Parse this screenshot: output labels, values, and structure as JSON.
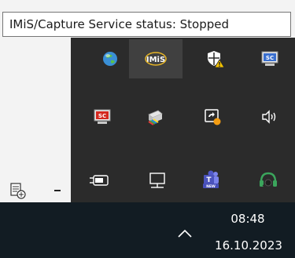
{
  "tooltip": {
    "text": "IMiS/Capture Service status: Stopped"
  },
  "tray": {
    "icons": [
      {
        "name": "edge-globe-icon"
      },
      {
        "name": "imis-capture-icon",
        "label": "IMiS"
      },
      {
        "name": "defender-warning-icon"
      },
      {
        "name": "sc-monitor-icon",
        "label": "SC"
      },
      {
        "name": "sc-monitor-red-icon",
        "label": "SC"
      },
      {
        "name": "printer-color-icon"
      },
      {
        "name": "screen-update-icon"
      },
      {
        "name": "speaker-icon"
      },
      {
        "name": "power-plug-icon"
      },
      {
        "name": "network-monitor-icon"
      },
      {
        "name": "teams-new-icon",
        "label": "T",
        "badge": "NEW"
      },
      {
        "name": "headset-icon"
      }
    ]
  },
  "taskbar": {
    "time": "08:48",
    "date": "16.10.2023"
  },
  "colors": {
    "flyout_bg": "#2b2b2b",
    "taskbar_bg": "#121c23",
    "highlight_bg": "#404040"
  }
}
